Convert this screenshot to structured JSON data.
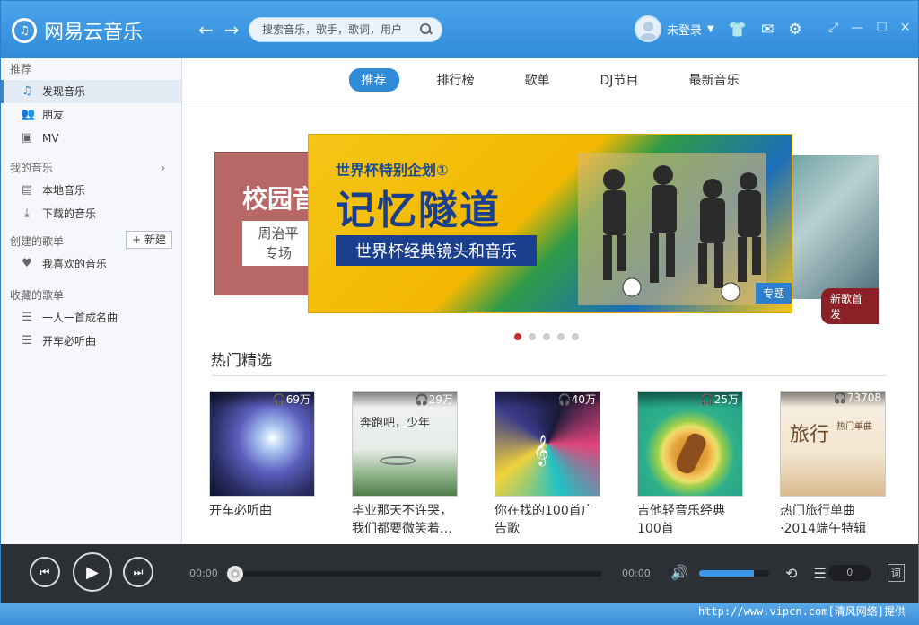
{
  "app": {
    "title": "网易云音乐"
  },
  "search": {
    "placeholder": "搜索音乐，歌手，歌词，用户"
  },
  "user": {
    "status": "未登录"
  },
  "sidebar": {
    "sections": [
      {
        "title": "推荐",
        "items": [
          {
            "label": "发现音乐",
            "icon": "music-note-icon",
            "active": true
          },
          {
            "label": "朋友",
            "icon": "friends-icon"
          },
          {
            "label": "MV",
            "icon": "mv-icon"
          }
        ]
      },
      {
        "title": "我的音乐",
        "items": [
          {
            "label": "本地音乐",
            "icon": "disk-icon"
          },
          {
            "label": "下载的音乐",
            "icon": "download-icon"
          }
        ]
      },
      {
        "title": "创建的歌单",
        "items": [
          {
            "label": "我喜欢的音乐",
            "icon": "heart-icon"
          }
        ]
      },
      {
        "title": "收藏的歌单",
        "items": [
          {
            "label": "一人一首成名曲",
            "icon": "playlist-icon"
          },
          {
            "label": "开车必听曲",
            "icon": "playlist-icon"
          }
        ]
      }
    ],
    "new_button": "+ 新建"
  },
  "tabs": [
    "推荐",
    "排行榜",
    "歌单",
    "DJ节目",
    "最新音乐"
  ],
  "banner": {
    "left_title": "校园音",
    "left_box_line1": "周治平",
    "left_box_line2": "专场",
    "subtitle": "世界杯特别企划①",
    "title": "记忆隧道",
    "strip": "世界杯经典镜头和音乐",
    "tag": "专题",
    "right_badge": "新歌首发"
  },
  "hot": {
    "title": "热门精选",
    "cards": [
      {
        "count": "69万",
        "title": "开车必听曲"
      },
      {
        "count": "29万",
        "title": "毕业那天不许哭，我们都要微笑着…",
        "cover_text": "奔跑吧，少年"
      },
      {
        "count": "40万",
        "title": "你在找的100首广告歌"
      },
      {
        "count": "25万",
        "title": "吉他轻音乐经典100首"
      },
      {
        "count": "73708",
        "title": "热门旅行单曲·2014端午特辑",
        "cover_text": "旅行",
        "cover_sub": "热门单曲"
      }
    ]
  },
  "player": {
    "time_current": "00:00",
    "time_total": "00:00",
    "playlist_count": "0",
    "volume_level": 0.78
  },
  "watermark": "http://www.vipcn.com[清风网络]提供"
}
